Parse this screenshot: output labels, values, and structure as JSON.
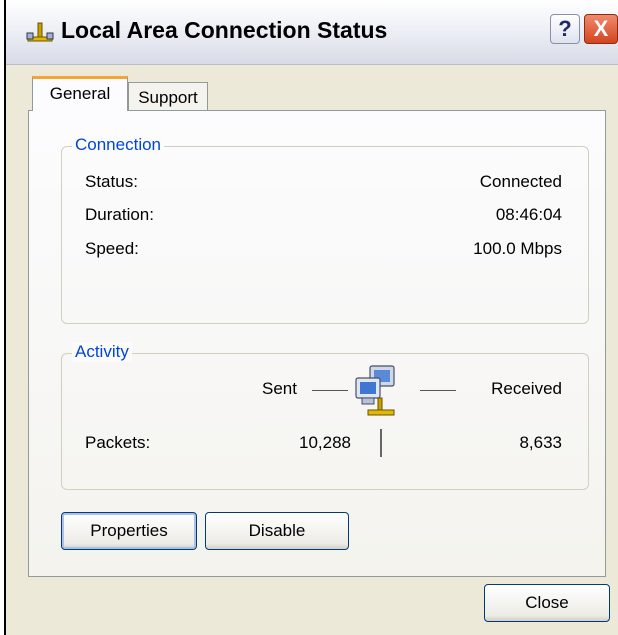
{
  "window": {
    "title": "Local Area Connection Status",
    "help_label": "?",
    "close_label": "X"
  },
  "tabs": [
    {
      "label": "General",
      "selected": true
    },
    {
      "label": "Support",
      "selected": false
    }
  ],
  "connection": {
    "legend": "Connection",
    "status_label": "Status:",
    "status_value": "Connected",
    "duration_label": "Duration:",
    "duration_value": "08:46:04",
    "speed_label": "Speed:",
    "speed_value": "100.0 Mbps"
  },
  "activity": {
    "legend": "Activity",
    "sent_label": "Sent",
    "received_label": "Received",
    "packets_label": "Packets:",
    "packets_sent": "10,288",
    "packets_received": "8,633"
  },
  "buttons": {
    "properties": "Properties",
    "disable": "Disable",
    "close": "Close"
  },
  "colors": {
    "accent_legend": "#0046d5",
    "tab_highlight": "#f3a536",
    "dialog_bg": "#ece9d8"
  }
}
